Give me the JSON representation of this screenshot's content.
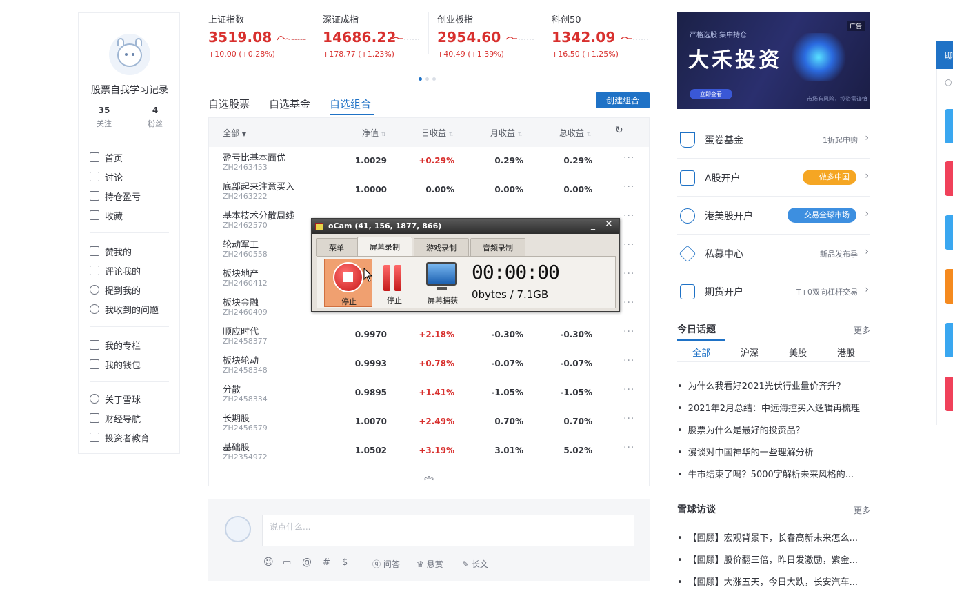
{
  "profile": {
    "name": "股票自我学习记录",
    "following_count": "35",
    "following_label": "关注",
    "followers_count": "4",
    "followers_label": "粉丝",
    "nav_main": [
      "首页",
      "讨论",
      "持仓盈亏",
      "收藏"
    ],
    "nav_mine": [
      "赞我的",
      "评论我的",
      "提到我的",
      "我收到的问题"
    ],
    "nav_wallet": [
      "我的专栏",
      "我的钱包"
    ],
    "nav_about": [
      "关于雪球",
      "财经导航",
      "投资者教育"
    ]
  },
  "indices": [
    {
      "name": "上证指数",
      "value": "3519.08",
      "change": "+10.00 (+0.28%)"
    },
    {
      "name": "深证成指",
      "value": "14686.22",
      "change": "+178.77 (+1.23%)"
    },
    {
      "name": "创业板指",
      "value": "2954.60",
      "change": "+40.49 (+1.39%)"
    },
    {
      "name": "科创50",
      "value": "1342.09",
      "change": "+16.50 (+1.25%)"
    }
  ],
  "tabs": {
    "items": [
      "自选股票",
      "自选基金",
      "自选组合"
    ],
    "active": 2,
    "create_button": "创建组合"
  },
  "table": {
    "headers": [
      "全部",
      "净值",
      "日收益",
      "月收益",
      "总收益"
    ],
    "rows": [
      {
        "name": "盈亏比基本面优",
        "code": "ZH2463453",
        "nav": "1.0029",
        "day": "+0.29%",
        "month": "0.29%",
        "total": "0.29%"
      },
      {
        "name": "底部起来注意买入",
        "code": "ZH2463222",
        "nav": "1.0000",
        "day": "0.00%",
        "month": "0.00%",
        "total": "0.00%"
      },
      {
        "name": "基本技术分散周线",
        "code": "ZH2462570",
        "nav": "",
        "day": "",
        "month": "",
        "total": ""
      },
      {
        "name": "轮动军工",
        "code": "ZH2460558",
        "nav": "",
        "day": "",
        "month": "",
        "total": ""
      },
      {
        "name": "板块地产",
        "code": "ZH2460412",
        "nav": "",
        "day": "",
        "month": "",
        "total": ""
      },
      {
        "name": "板块金融",
        "code": "ZH2460409",
        "nav": "",
        "day": "",
        "month": "",
        "total": ""
      },
      {
        "name": "顺应时代",
        "code": "ZH2458377",
        "nav": "0.9970",
        "day": "+2.18%",
        "month": "-0.30%",
        "total": "-0.30%"
      },
      {
        "name": "板块轮动",
        "code": "ZH2458348",
        "nav": "0.9993",
        "day": "+0.78%",
        "month": "-0.07%",
        "total": "-0.07%"
      },
      {
        "name": "分散",
        "code": "ZH2458334",
        "nav": "0.9895",
        "day": "+1.41%",
        "month": "-1.05%",
        "total": "-1.05%"
      },
      {
        "name": "长期股",
        "code": "ZH2456579",
        "nav": "1.0070",
        "day": "+2.49%",
        "month": "0.70%",
        "total": "0.70%"
      },
      {
        "name": "基础股",
        "code": "ZH2354972",
        "nav": "1.0502",
        "day": "+3.19%",
        "month": "3.01%",
        "total": "5.02%"
      }
    ],
    "more_glyph": "···",
    "collapse_glyph": "︽"
  },
  "comment": {
    "placeholder": "说点什么...",
    "tools": [
      "☺",
      "▭",
      "@",
      "#",
      "$"
    ],
    "tool_labels": [
      "问答",
      "悬赏",
      "长文"
    ]
  },
  "ocam": {
    "title": "oCam (41, 156, 1877, 866)",
    "tabs": [
      "菜单",
      "屏幕录制",
      "游戏录制",
      "音频录制"
    ],
    "active_tab": 1,
    "stop_label": "停止",
    "pause_label": "停止",
    "capture_label": "屏幕捕获",
    "timer": "00:00:00",
    "bytes": "0bytes / 7.1GB",
    "min_glyph": "_",
    "close_glyph": "✕"
  },
  "ad": {
    "subtitle": "严格选股 集中持仓",
    "title": "大禾投资",
    "button": "立即查看",
    "tag": "广告",
    "footer": "市场有风险，投资需谨慎"
  },
  "services": [
    {
      "name": "蛋卷基金",
      "tag": "1折起申购",
      "icon": "cup-icon"
    },
    {
      "name": "A股开户",
      "pill": "做多中国",
      "pill_color": "#f5a623",
      "icon": "chart-icon"
    },
    {
      "name": "港美股开户",
      "pill": "交易全球市场",
      "pill_color": "#3d8fe0",
      "icon": "globe-icon"
    },
    {
      "name": "私募中心",
      "tag": "新品发布季",
      "icon": "diamond-icon"
    },
    {
      "name": "期货开户",
      "tag": "T+0双向杠杆交易",
      "icon": "doc-icon"
    }
  ],
  "topics": {
    "title": "今日话题",
    "more": "更多",
    "tabs": [
      "全部",
      "沪深",
      "美股",
      "港股"
    ],
    "items": [
      "为什么我看好2021光伏行业量价齐升？",
      "2021年2月总结：中远海控买入逻辑再梳理",
      "股票为什么是最好的投资品？",
      "漫谈对中国神华的一些理解分析",
      "牛市结束了吗？5000字解析未来风格的..."
    ]
  },
  "interviews": {
    "title": "雪球访谈",
    "more": "更多",
    "items": [
      "【回顾】宏观背景下，长春高新未来怎么...",
      "【回顾】股价翻三倍，昨日发激励，紫金...",
      "【回顾】大涨五天，今日大跌，长安汽车..."
    ]
  },
  "strip_label": "聊",
  "colors": {
    "accent": "#1f72c6",
    "up": "#d8302e"
  }
}
